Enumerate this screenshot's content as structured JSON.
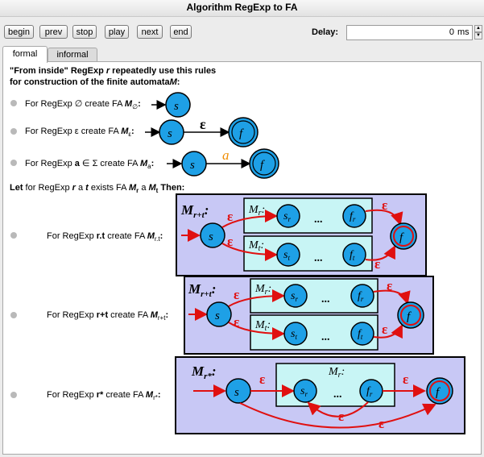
{
  "window": {
    "title": "Algorithm RegExp to FA"
  },
  "toolbar": {
    "begin": "begin",
    "prev": "prev",
    "stop": "stop",
    "play": "play",
    "next": "next",
    "end": "end",
    "delay_label": "Delay:",
    "delay_value": "0",
    "delay_unit": "ms"
  },
  "tabs": [
    {
      "label": "formal",
      "active": true
    },
    {
      "label": "informal",
      "active": false
    }
  ],
  "content": {
    "intro_line1_a": "\"From inside\" RegExp ",
    "intro_line1_r": "r",
    "intro_line1_b": " repeatedly use this rules",
    "intro_line2_a": "for construction of the finite automata",
    "intro_line2_m": "M",
    "intro_line2_b": ":",
    "rule_empty": {
      "text": "For RegExp ∅ create FA ",
      "m": "M",
      "sub": "∅",
      "colon": ":"
    },
    "rule_epsilon": {
      "text": "For RegExp ε create FA ",
      "m": "M",
      "sub": "ε",
      "colon": ":"
    },
    "rule_symbol": {
      "text_a": "For RegExp ",
      "a": "a",
      "text_b": " ∈ Σ create FA ",
      "m": "M",
      "sub": "a",
      "colon": ":"
    },
    "let_line": {
      "a": "Let",
      "b": " for RegExp ",
      "r": "r",
      "c": " a ",
      "t": "t",
      "d": " exists FA ",
      "mr": "M",
      "mr_sub": "r",
      "e": " a ",
      "mt": "M",
      "mt_sub": "t",
      "f": " Then:"
    },
    "rule_concat": {
      "a": "For RegExp ",
      "expr": "r.t",
      "b": " create FA ",
      "m": "M",
      "sub": "r.t",
      "colon": ":"
    },
    "rule_union": {
      "a": "For RegExp ",
      "expr": "r+t",
      "b": " create FA ",
      "m": "M",
      "sub": "r+t",
      "colon": ":"
    },
    "rule_star": {
      "a": "For RegExp ",
      "expr": "r*",
      "b": " create FA ",
      "m": "M",
      "sub": "r*",
      "colon": ":"
    }
  },
  "diagram_labels": {
    "s": "s",
    "f": "f",
    "epsilon": "ε",
    "a": "a",
    "dots": "...",
    "sr": "s",
    "sr_sub": "r",
    "fr": "f",
    "fr_sub": "r",
    "st": "s",
    "st_sub": "t",
    "ft": "f",
    "ft_sub": "t",
    "M": "M",
    "r": "r",
    "t": "t",
    "rt": "r+t",
    "rstar": "r*"
  },
  "colors": {
    "state_fill": "#1ea0e6",
    "box_fill": "#c8c8f5",
    "inner_fill": "#c8f5f5",
    "epsilon_red": "#e01010",
    "symbol_orange": "#f08c00"
  }
}
